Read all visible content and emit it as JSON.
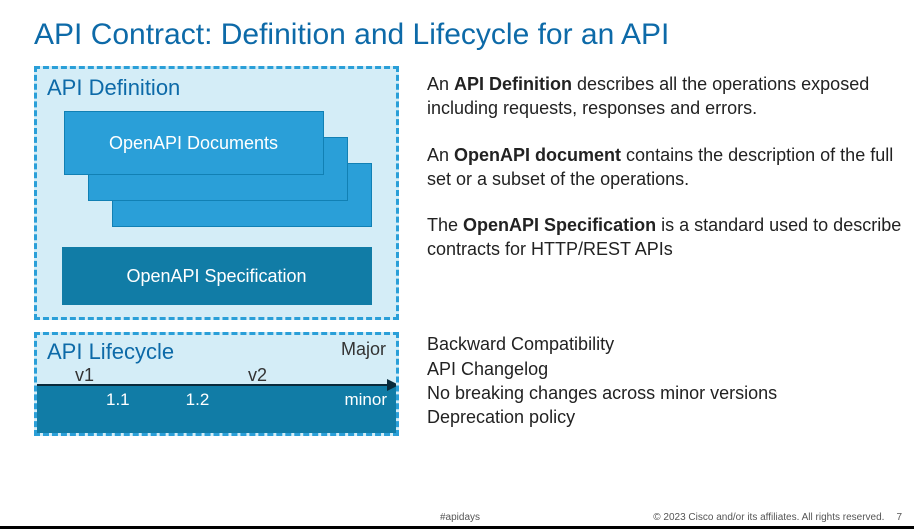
{
  "title": "API Contract: Definition and Lifecycle for an API",
  "definition": {
    "box_title": "API Definition",
    "docs_label": "OpenAPI Documents",
    "spec_label": "OpenAPI Specification"
  },
  "lifecycle": {
    "box_title": "API Lifecycle",
    "major_label": "Major",
    "v1": "v1",
    "v2": "v2",
    "minor1": "1.1",
    "minor2": "1.2",
    "minor_label": "minor"
  },
  "paragraphs": {
    "p1_prefix": "An ",
    "p1_bold": "API Definition",
    "p1_rest": " describes all the operations exposed including requests, responses and errors.",
    "p2_prefix": "An ",
    "p2_bold": "OpenAPI document",
    "p2_rest": " contains the description of the full set or a subset of the operations.",
    "p3_prefix": "The ",
    "p3_bold": "OpenAPI Specification",
    "p3_rest": " is a standard used to describe contracts for HTTP/REST APIs"
  },
  "compat": {
    "title": "Backward Compatibility",
    "line1": "API Changelog",
    "line2": "No breaking changes across minor versions",
    "line3": "Deprecation policy"
  },
  "footer": {
    "hashtag": "#apidays",
    "copyright": "© 2023  Cisco and/or its affiliates. All rights reserved.",
    "page": "7"
  }
}
